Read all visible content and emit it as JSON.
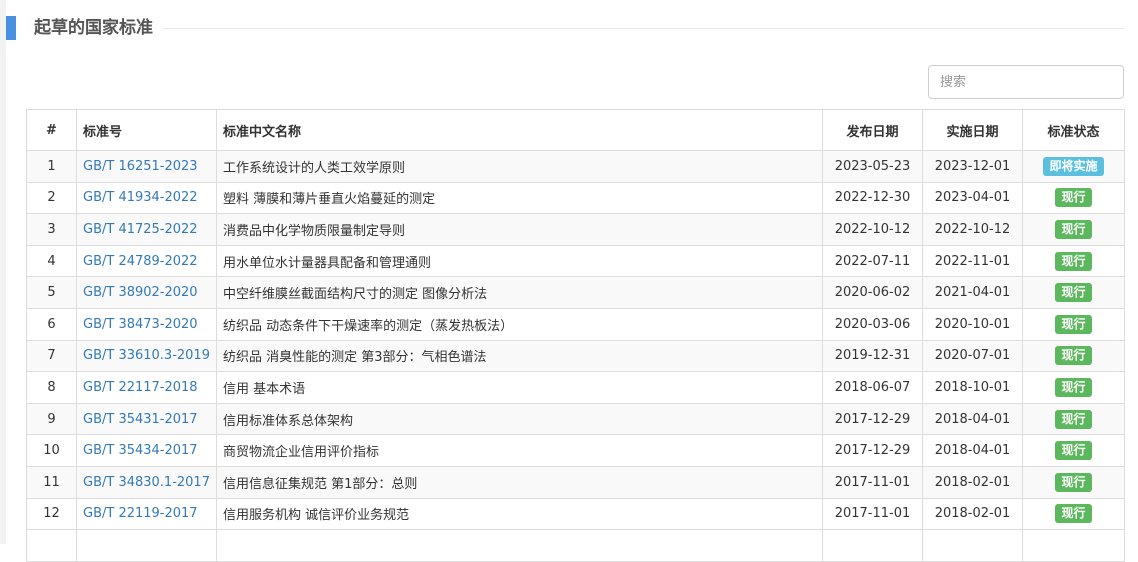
{
  "section": {
    "title": "起草的国家标准"
  },
  "search": {
    "placeholder": "搜索"
  },
  "table": {
    "headers": {
      "index": "#",
      "code": "标准号",
      "name": "标准中文名称",
      "publish_date": "发布日期",
      "effective_date": "实施日期",
      "status": "标准状态"
    },
    "rows": [
      {
        "index": "1",
        "code": "GB/T 16251-2023",
        "name": "工作系统设计的人类工效学原则",
        "publish_date": "2023-05-23",
        "effective_date": "2023-12-01",
        "status": "即将实施",
        "status_type": "upcoming"
      },
      {
        "index": "2",
        "code": "GB/T 41934-2022",
        "name": "塑料 薄膜和薄片垂直火焰蔓延的测定",
        "publish_date": "2022-12-30",
        "effective_date": "2023-04-01",
        "status": "现行",
        "status_type": "current"
      },
      {
        "index": "3",
        "code": "GB/T 41725-2022",
        "name": "消费品中化学物质限量制定导则",
        "publish_date": "2022-10-12",
        "effective_date": "2022-10-12",
        "status": "现行",
        "status_type": "current"
      },
      {
        "index": "4",
        "code": "GB/T 24789-2022",
        "name": "用水单位水计量器具配备和管理通则",
        "publish_date": "2022-07-11",
        "effective_date": "2022-11-01",
        "status": "现行",
        "status_type": "current"
      },
      {
        "index": "5",
        "code": "GB/T 38902-2020",
        "name": "中空纤维膜丝截面结构尺寸的测定 图像分析法",
        "publish_date": "2020-06-02",
        "effective_date": "2021-04-01",
        "status": "现行",
        "status_type": "current"
      },
      {
        "index": "6",
        "code": "GB/T 38473-2020",
        "name": "纺织品 动态条件下干燥速率的测定（蒸发热板法）",
        "publish_date": "2020-03-06",
        "effective_date": "2020-10-01",
        "status": "现行",
        "status_type": "current"
      },
      {
        "index": "7",
        "code": "GB/T 33610.3-2019",
        "name": "纺织品 消臭性能的测定 第3部分：气相色谱法",
        "publish_date": "2019-12-31",
        "effective_date": "2020-07-01",
        "status": "现行",
        "status_type": "current"
      },
      {
        "index": "8",
        "code": "GB/T 22117-2018",
        "name": "信用 基本术语",
        "publish_date": "2018-06-07",
        "effective_date": "2018-10-01",
        "status": "现行",
        "status_type": "current"
      },
      {
        "index": "9",
        "code": "GB/T 35431-2017",
        "name": "信用标准体系总体架构",
        "publish_date": "2017-12-29",
        "effective_date": "2018-04-01",
        "status": "现行",
        "status_type": "current"
      },
      {
        "index": "10",
        "code": "GB/T 35434-2017",
        "name": "商贸物流企业信用评价指标",
        "publish_date": "2017-12-29",
        "effective_date": "2018-04-01",
        "status": "现行",
        "status_type": "current"
      },
      {
        "index": "11",
        "code": "GB/T 34830.1-2017",
        "name": "信用信息征集规范 第1部分：总则",
        "publish_date": "2017-11-01",
        "effective_date": "2018-02-01",
        "status": "现行",
        "status_type": "current"
      },
      {
        "index": "12",
        "code": "GB/T 22119-2017",
        "name": "信用服务机构 诚信评价业务规范",
        "publish_date": "2017-11-01",
        "effective_date": "2018-02-01",
        "status": "现行",
        "status_type": "current"
      }
    ]
  }
}
